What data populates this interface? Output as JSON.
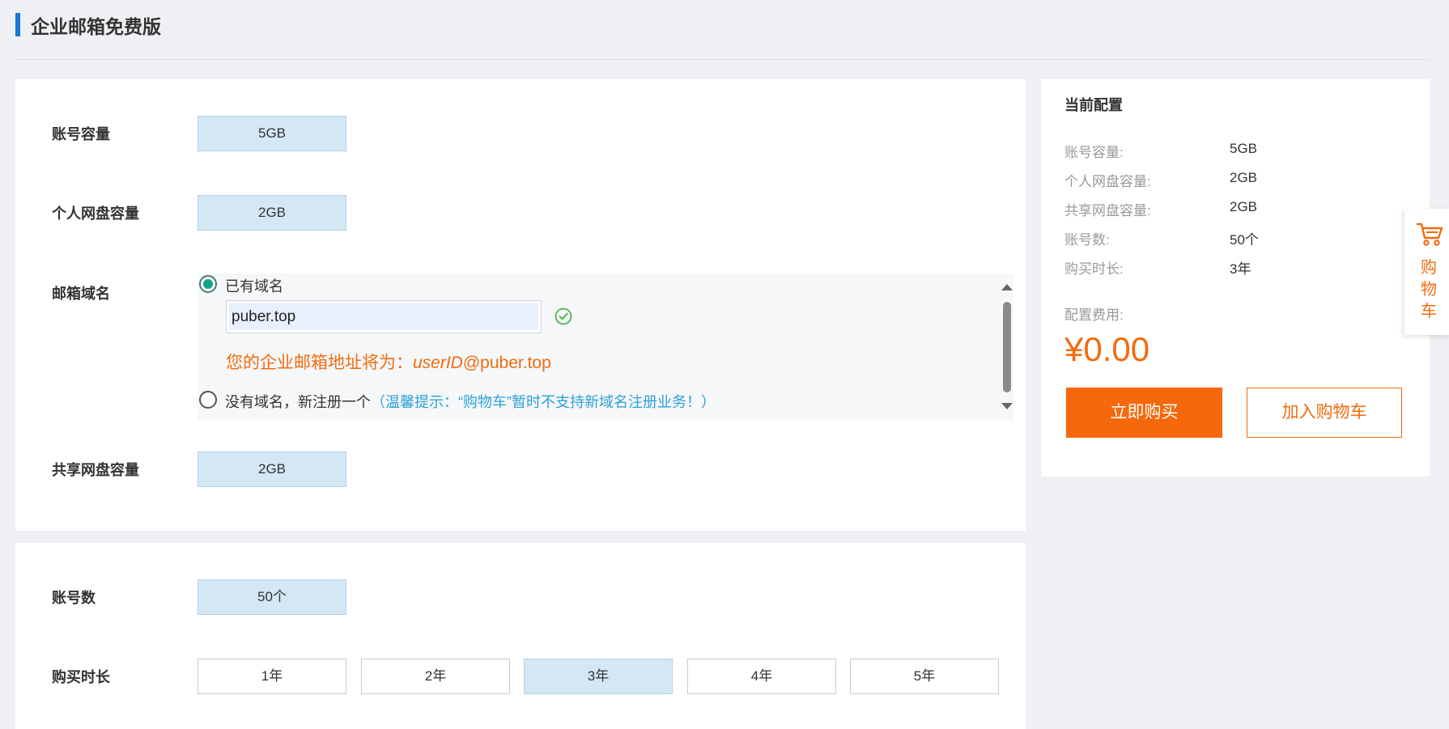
{
  "header": {
    "title": "企业邮箱免费版"
  },
  "config": {
    "account_capacity": {
      "label": "账号容量",
      "options": [
        "5GB"
      ],
      "selected": "5GB"
    },
    "personal_disk": {
      "label": "个人网盘容量",
      "options": [
        "2GB"
      ],
      "selected": "2GB"
    },
    "domain": {
      "label": "邮箱域名",
      "has_domain_label": "已有域名",
      "domain_value": "puber.top",
      "address_prefix": "您的企业邮箱地址将为：",
      "address_uid": "userID",
      "address_suffix": "@puber.top",
      "no_domain_label": "没有域名，新注册一个",
      "no_domain_hint": "（温馨提示：“购物车”暂时不支持新域名注册业务！）",
      "selected": "has_domain"
    },
    "shared_disk": {
      "label": "共享网盘容量",
      "options": [
        "2GB"
      ],
      "selected": "2GB"
    },
    "account_count": {
      "label": "账号数",
      "options": [
        "50个"
      ],
      "selected": "50个"
    },
    "duration": {
      "label": "购买时长",
      "options": [
        "1年",
        "2年",
        "3年",
        "4年",
        "5年"
      ],
      "selected": "3年"
    }
  },
  "summary": {
    "title": "当前配置",
    "rows": [
      {
        "label": "账号容量:",
        "value": "5GB"
      },
      {
        "label": "个人网盘容量:",
        "value": "2GB"
      },
      {
        "label": "共享网盘容量:",
        "value": "2GB"
      },
      {
        "label": "账号数:",
        "value": "50个"
      },
      {
        "label": "购买时长:",
        "value": "3年"
      }
    ],
    "fee_label": "配置费用:",
    "price": "¥0.00",
    "buy_label": "立即购买",
    "add_cart_label": "加入购物车"
  },
  "float_cart": {
    "label": "购物车",
    "icon": "cart-icon"
  },
  "colors": {
    "accent": "#f5680c",
    "brand_blue": "#1677d2",
    "selected_bg": "#d4e7f5",
    "hint": "#2ba1d9"
  }
}
